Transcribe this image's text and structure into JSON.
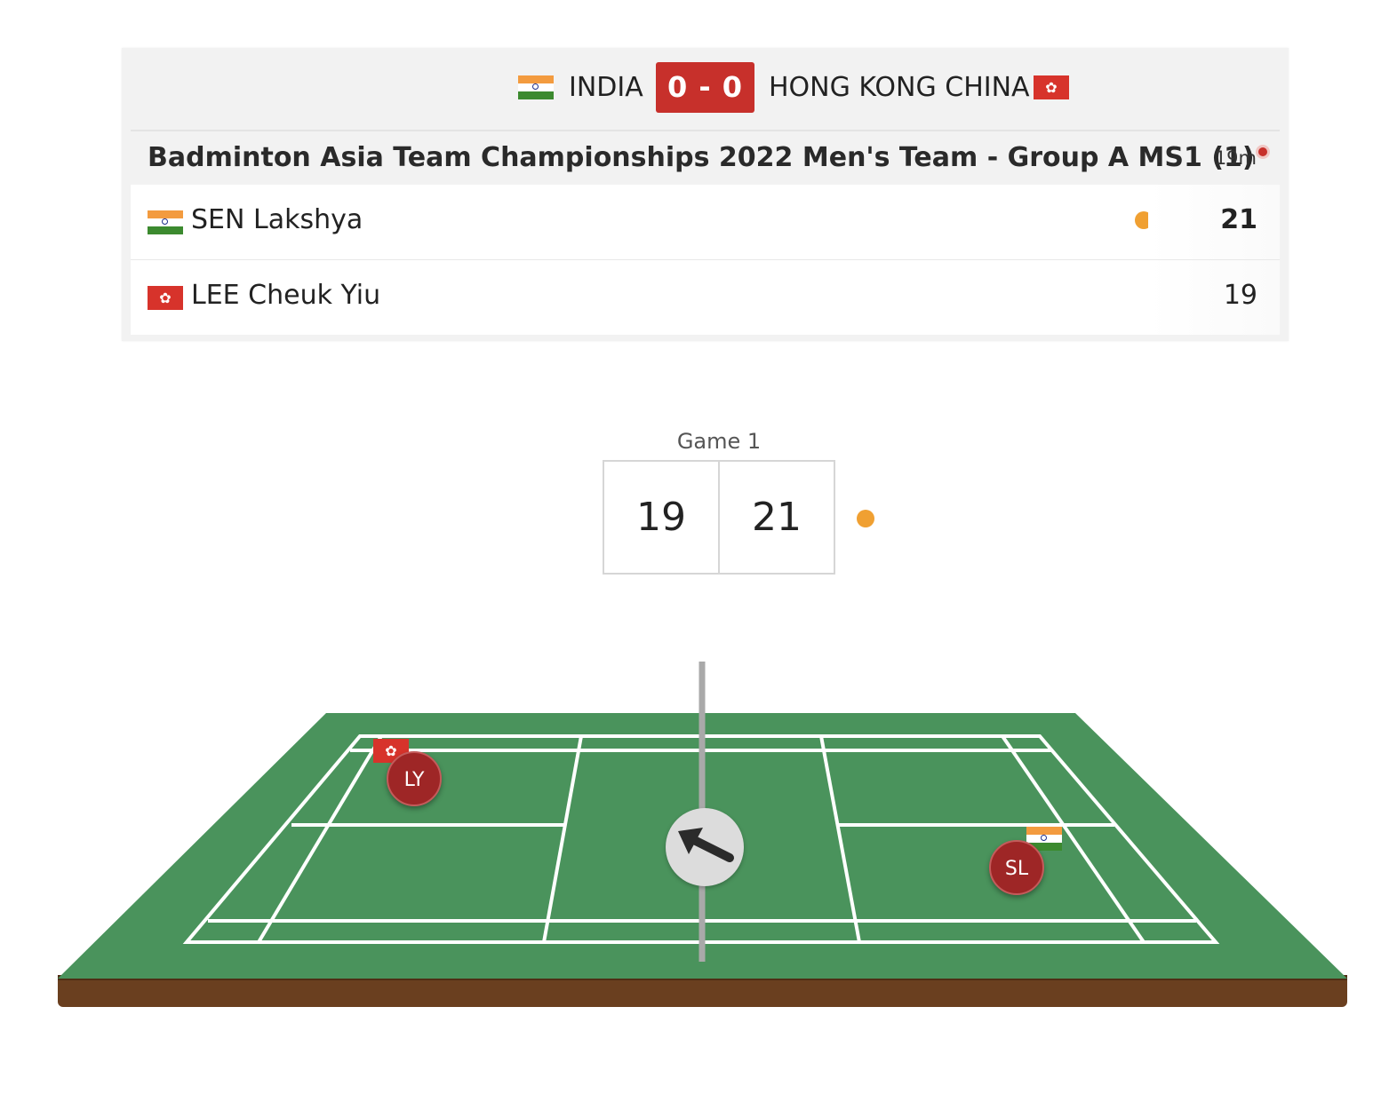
{
  "header": {
    "team_a": {
      "name": "INDIA",
      "flag": "flag-india"
    },
    "team_score": "0 - 0",
    "team_b": {
      "name": "HONG KONG CHINA",
      "flag": "flag-hong-kong"
    }
  },
  "event": {
    "title": "Badminton Asia Team Championships 2022 Men's Team - Group A MS1 (1)",
    "duration": "19m"
  },
  "players": [
    {
      "name": "SEN Lakshya",
      "flag": "flag-india",
      "score": "21",
      "serving": true
    },
    {
      "name": "LEE Cheuk Yiu",
      "flag": "flag-hong-kong",
      "score": "19",
      "serving": false
    }
  ],
  "game": {
    "label": "Game 1",
    "score_left": "19",
    "score_right": "21"
  },
  "court": {
    "marker_left": "LY",
    "marker_right": "SL",
    "shuttle_icon": "arrow-up-left-icon"
  },
  "colors": {
    "accent_red": "#c7302b",
    "serve_orange": "#f0a032",
    "court_green": "#4a935c",
    "court_base_brown": "#6a3f1f"
  }
}
